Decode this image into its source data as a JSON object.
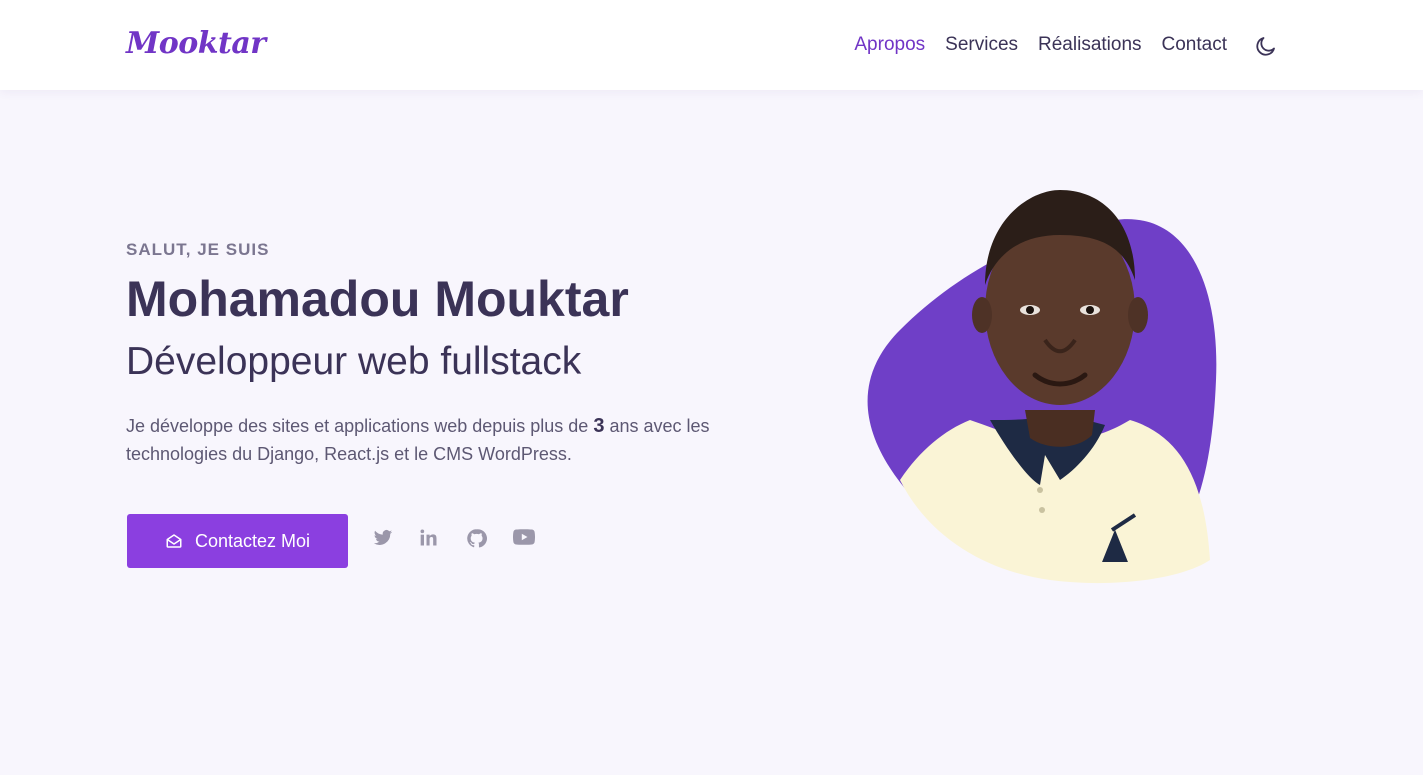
{
  "header": {
    "logo": "Mooktar",
    "nav": [
      {
        "label": "Apropos"
      },
      {
        "label": "Services"
      },
      {
        "label": "Réalisations"
      },
      {
        "label": "Contact"
      }
    ],
    "theme_toggle_icon": "moon-icon"
  },
  "hero": {
    "greeting": "SALUT, JE SUIS",
    "name": "Mohamadou Mouktar",
    "role": "Développeur web fullstack",
    "desc_part1": "Je développe des sites et applications web depuis plus de ",
    "desc_years": "3",
    "desc_part2": " ans avec les technologies du Django, React.js et le CMS WordPress.",
    "cta_label": "Contactez Moi",
    "cta_icon": "mail-open-icon",
    "socials": [
      "twitter-icon",
      "linkedin-icon",
      "github-icon",
      "youtube-icon"
    ]
  },
  "colors": {
    "accent": "#7135c6",
    "button": "#8b3fe0",
    "blob": "#6f3fc7",
    "background": "#f8f6fd",
    "text": "#3b3357"
  }
}
